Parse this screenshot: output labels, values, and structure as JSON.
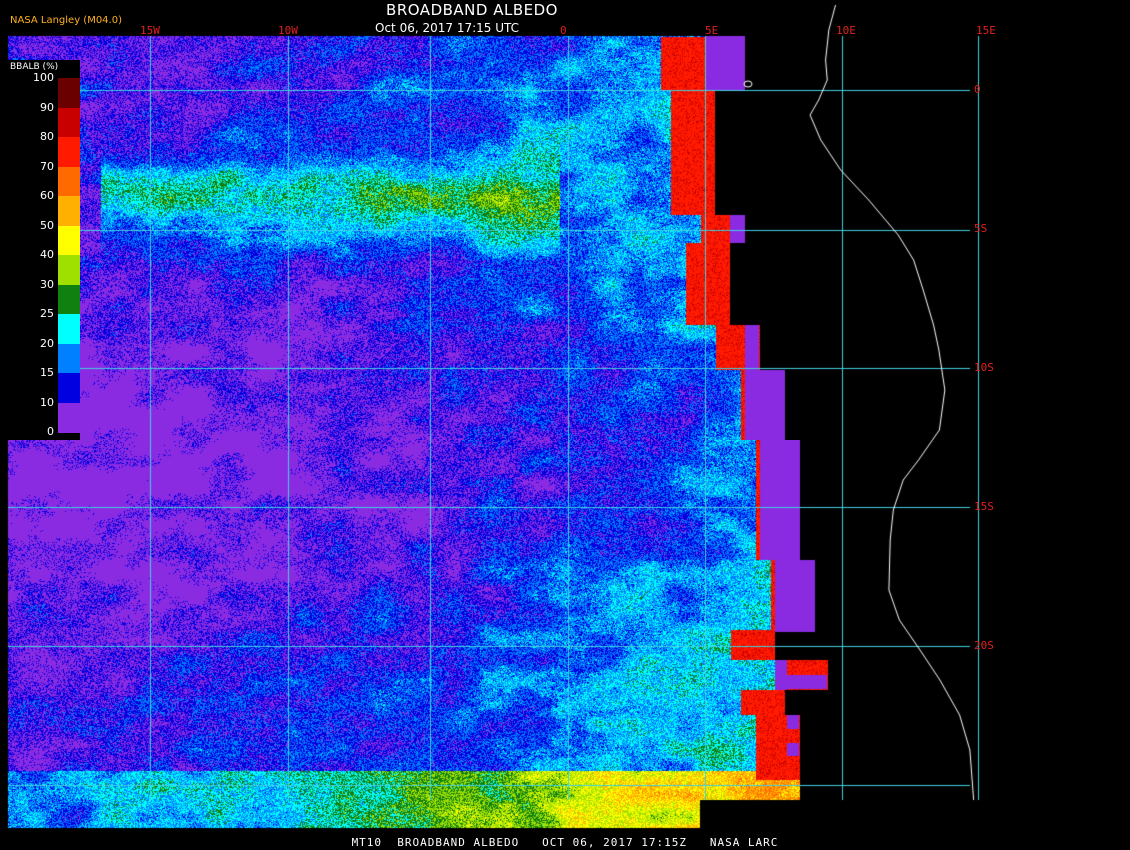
{
  "header": {
    "title": "BROADBAND ALBEDO",
    "subtitle": "Oct 06, 2017 17:15 UTC",
    "producer": "NASA Langley (M04.0)"
  },
  "footer": "MT10  BROADBAND ALBEDO   OCT 06, 2017 17:15Z   NASA LARC",
  "map": {
    "longitude_labels": [
      "15W",
      "10W",
      "0",
      "5E",
      "10E",
      "15E"
    ],
    "latitude_labels": [
      "0",
      "5S",
      "10S",
      "15S",
      "20S"
    ],
    "grid_color": "#40d0e0",
    "label_color": "#e02020",
    "land_color": "#000000",
    "coast_color": "#ffffff"
  },
  "legend": {
    "title": "BBALB (%)",
    "ticks": [
      "100",
      "90",
      "80",
      "70",
      "60",
      "50",
      "40",
      "30",
      "25",
      "20",
      "15",
      "10",
      "0"
    ],
    "colors": [
      "#6b0000",
      "#c80000",
      "#ff1a00",
      "#ff6a00",
      "#ffb000",
      "#ffff00",
      "#a0e000",
      "#108010",
      "#00ffff",
      "#0080ff",
      "#0000e0",
      "#8a2be2"
    ]
  }
}
